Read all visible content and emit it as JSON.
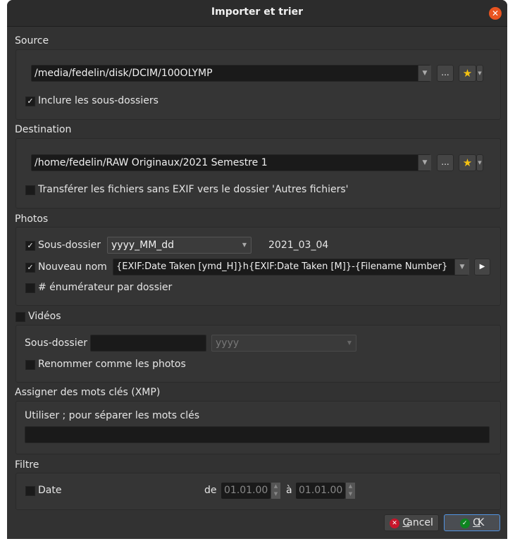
{
  "window": {
    "title": "Importer et trier"
  },
  "source": {
    "label": "Source",
    "path": "/media/fedelin/disk/DCIM/100OLYMP",
    "browse": "...",
    "include_subfolders": {
      "label": "Inclure les sous-dossiers",
      "checked": true
    }
  },
  "destination": {
    "label": "Destination",
    "path": "/home/fedelin/RAW Originaux/2021 Semestre 1",
    "browse": "...",
    "no_exif": {
      "label": "Transférer les fichiers sans EXIF vers le dossier 'Autres fichiers'",
      "checked": false
    }
  },
  "photos": {
    "label": "Photos",
    "subfolder": {
      "label": "Sous-dossier",
      "checked": true,
      "format": "yyyy_MM_dd",
      "preview": "2021_03_04"
    },
    "rename": {
      "label": "Nouveau nom",
      "checked": true,
      "pattern": "{EXIF:Date Taken [ymd_H]}h{EXIF:Date Taken [M]}-{Filename Number}"
    },
    "enumerator": {
      "label": "# énumérateur par dossier",
      "checked": false
    }
  },
  "videos": {
    "label": "Vidéos",
    "checked": false,
    "subfolder_label": "Sous-dossier",
    "subfolder_value": "",
    "format": "yyyy",
    "rename_like_photos": {
      "label": "Renommer comme les photos",
      "checked": false
    }
  },
  "keywords": {
    "label": "Assigner des mots clés (XMP)",
    "hint": "Utiliser ; pour séparer les mots clés",
    "value": ""
  },
  "filter": {
    "label": "Filtre",
    "date": {
      "label": "Date",
      "checked": false
    },
    "from_label": "de",
    "from": "01.01.00",
    "to_label": "à",
    "to": "01.01.00"
  },
  "buttons": {
    "cancel_u": "C",
    "cancel_rest": "ancel",
    "ok_u": "O",
    "ok_rest": "K"
  },
  "colors": {
    "accent": "#e95420",
    "cancel_icon": "#c7162b",
    "ok_icon": "#0e8420",
    "focus": "#5294e2"
  }
}
